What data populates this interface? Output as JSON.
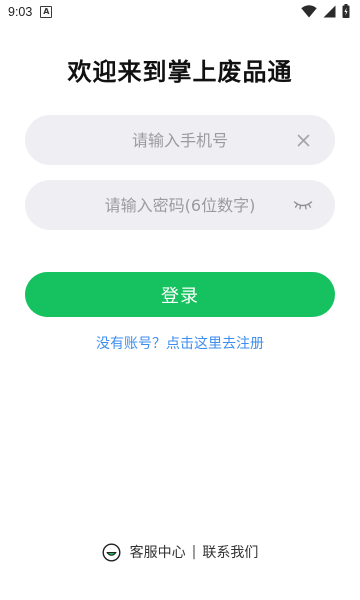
{
  "status_bar": {
    "time": "9:03",
    "app_notification_icon": "a-letter-icon",
    "icons": [
      "wifi-icon",
      "cellular-signal-icon",
      "battery-icon"
    ]
  },
  "app": {
    "title": "欢迎来到掌上废品通"
  },
  "form": {
    "phone": {
      "placeholder": "请输入手机号",
      "value": "",
      "clear_icon": "close-icon"
    },
    "password": {
      "placeholder": "请输入密码(6位数字)",
      "value": "",
      "visibility_icon": "eye-closed-icon"
    },
    "login_label": "登录",
    "register_link": "没有账号？点击这里去注册"
  },
  "footer": {
    "icon": "customer-service-icon",
    "customer_service": "客服中心",
    "divider": "|",
    "contact_us": "联系我们"
  },
  "colors": {
    "primary": "#16c25f",
    "link": "#3e8ef0",
    "input_background": "#efeff3"
  }
}
